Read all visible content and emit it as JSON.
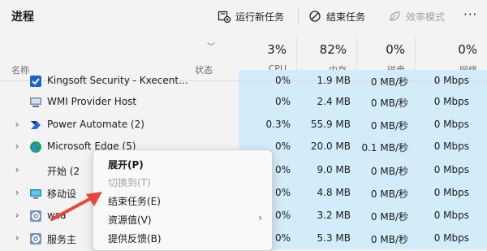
{
  "toolbar": {
    "title": "进程",
    "run_new_task": "运行新任务",
    "end_task": "结束任务",
    "efficiency_mode": "效率模式",
    "more": "···"
  },
  "header": {
    "name_col": "名称",
    "status_col": "状态",
    "cpu_pct": "3%",
    "cpu_label": "CPU",
    "mem_pct": "82%",
    "mem_label": "内存",
    "disk_pct": "0%",
    "disk_label": "磁盘",
    "net_pct": "0%",
    "net_label": "网络"
  },
  "rows": [
    {
      "name": "Kingsoft Security - Kxecent...",
      "cpu": "0%",
      "mem": "1.9 MB",
      "disk": "0 MB/秒",
      "net": "0 Mbps",
      "icon": "shield-check-icon"
    },
    {
      "name": "WMI Provider Host",
      "cpu": "0%",
      "mem": "2.4 MB",
      "disk": "0 MB/秒",
      "net": "0 Mbps",
      "icon": "server-icon"
    },
    {
      "name": "Power Automate (2)",
      "cpu": "0.3%",
      "mem": "55.9 MB",
      "disk": "0 MB/秒",
      "net": "0 Mbps",
      "icon": "power-automate-icon"
    },
    {
      "name": "Microsoft Edge (5)",
      "cpu": "0%",
      "mem": "20.0 MB",
      "disk": "0.1 MB/秒",
      "net": "0 Mbps",
      "icon": "edge-icon"
    },
    {
      "name": "开始 (2",
      "cpu": "0%",
      "mem": "9.0 MB",
      "disk": "0 MB/秒",
      "net": "0 Mbps",
      "icon": "start-icon"
    },
    {
      "name": "移动设",
      "cpu": "0%",
      "mem": "4.8 MB",
      "disk": "0 MB/秒",
      "net": "0 Mbps",
      "icon": "mobile-device-icon"
    },
    {
      "name": "wsa",
      "cpu": "0%",
      "mem": "3.2 MB",
      "disk": "0 MB/秒",
      "net": "0 Mbps",
      "icon": "gear-icon"
    },
    {
      "name": "服务主",
      "cpu": "0%",
      "mem": "5.3 MB",
      "disk": "0 MB/秒",
      "net": "0 Mbps",
      "icon": "gear-icon"
    }
  ],
  "context_menu": {
    "expand": "展开(P)",
    "switch_to": "切换到(T)",
    "end_task": "结束任务(E)",
    "resource_values": "资源值(V)",
    "feedback": "提供反馈(B)"
  },
  "colors": {
    "metric_bg": "#d2ecfa",
    "arrow": "#e8463a"
  }
}
